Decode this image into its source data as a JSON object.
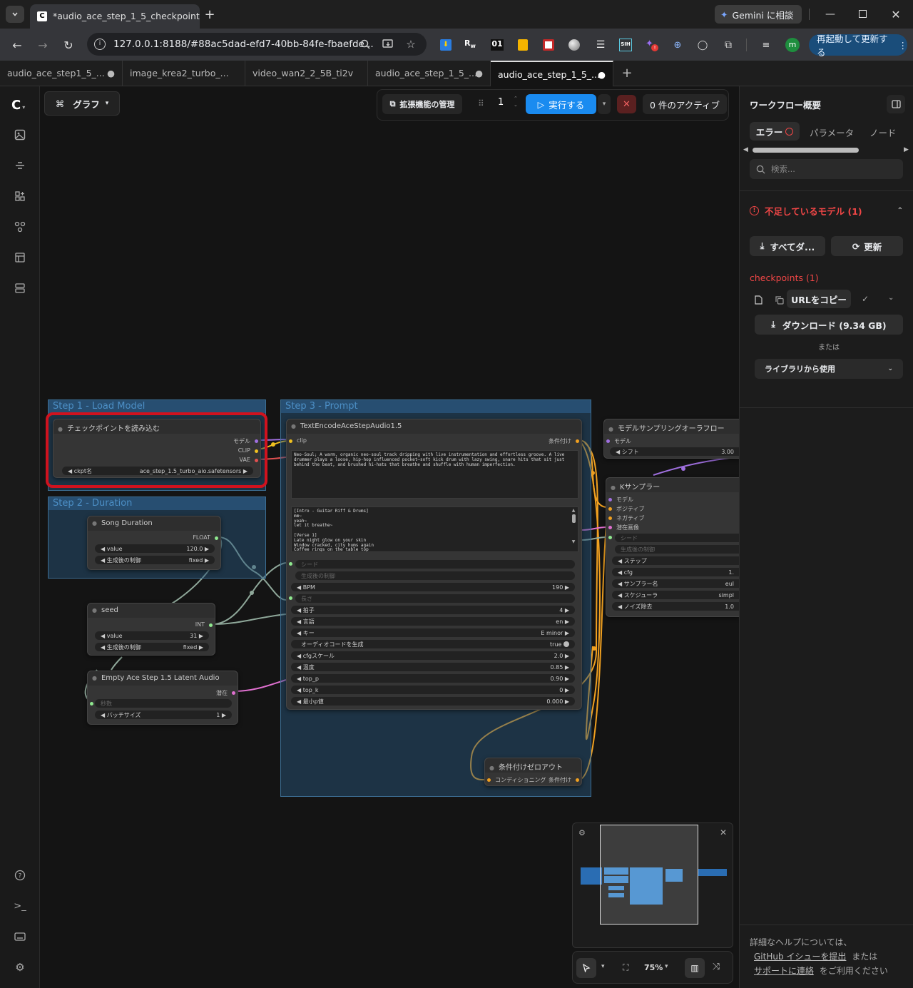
{
  "browser": {
    "active_tab_title": "*audio_ace_step_1_5_checkpoint",
    "url": "127.0.0.1:8188/#88ac5dad-efd7-40bb-84fe-fbaefde...",
    "gemini_label": "Gemini に相談",
    "restart_label": "再起動して更新する",
    "ext_text_01": "01",
    "profile_initial": "m"
  },
  "workflow_tabs": [
    {
      "label": "audio_ace_step1_5_..."
    },
    {
      "label": "image_krea2_turbo_..."
    },
    {
      "label": "video_wan2_2_5B_ti2v"
    },
    {
      "label": "audio_ace_step_1_5_..."
    },
    {
      "label": "audio_ace_step_1_5_..."
    }
  ],
  "canvas_toolbar": {
    "graph_label": "グラフ",
    "extensions_label": "拡張機能の管理",
    "queue_count": "1",
    "run_label": "実行する",
    "active_label": "0 件のアクティブ"
  },
  "groups": {
    "step1": "Step 1 - Load Model",
    "step2": "Step 2 - Duration",
    "step3": "Step 3 - Prompt"
  },
  "nodes": {
    "checkpoint": {
      "title": "チェックポイントを読み込む",
      "out_model": "モデル",
      "out_clip": "CLIP",
      "out_vae": "VAE",
      "ckpt_label": "ckpt名",
      "ckpt_value": "ace_step_1.5_turbo_aio.safetensors"
    },
    "song_duration": {
      "title": "Song Duration",
      "out": "FLOAT",
      "value_label": "value",
      "value": "120.0",
      "control_label": "生成後の制御",
      "control_value": "fixed"
    },
    "seed": {
      "title": "seed",
      "out": "INT",
      "value_label": "value",
      "value": "31",
      "control_label": "生成後の制御",
      "control_value": "fixed"
    },
    "latent": {
      "title": "Empty Ace Step 1.5 Latent Audio",
      "out": "潜在",
      "seconds_label": "秒数",
      "batch_label": "バッチサイズ",
      "batch_value": "1"
    },
    "text_encode": {
      "title": "TextEncodeAceStepAudio1.5",
      "in_clip": "clip",
      "out_cond": "条件付け",
      "tags": "Neo-Soul; A warm, organic neo-soul track dripping with live instrumentation and effortless groove. A live drummer plays a loose, hip-hop influenced pocket—soft kick drum with lazy swing, snare hits that sit just behind the beat, and brushed hi-hats that breathe and shuffle with human imperfection.",
      "lyrics": "[Intro - Guitar Riff & Drums]\nmm~\nyeah~\nlet it breathe~\n\n[Verse 1]\nLate night glow on your skin\nWindow cracked, city hums again\nCoffee rings on the table top",
      "seed_label": "シード",
      "control_label": "生成後の制御",
      "bpm_label": "BPM",
      "bpm_value": "190",
      "duration_label": "長さ",
      "timesig_label": "拍子",
      "timesig_value": "4",
      "lang_label": "言語",
      "lang_value": "en",
      "key_label": "キー",
      "key_value": "E minor",
      "audio_code_label": "オーディオコードを生成",
      "audio_code_value": "true",
      "cfg_label": "cfgスケール",
      "cfg_value": "2.0",
      "temp_label": "温度",
      "temp_value": "0.85",
      "topp_label": "top_p",
      "topp_value": "0.90",
      "topk_label": "top_k",
      "topk_value": "0",
      "minp_label": "最小p値",
      "minp_value": "0.000"
    },
    "zero_out": {
      "title": "条件付けゼロアウト",
      "in": "コンディショニング",
      "out": "条件付け"
    },
    "model_sampling": {
      "title": "モデルサンプリングオーラフロー",
      "in": "モデル",
      "shift_label": "シフト",
      "shift_value": "3.00"
    },
    "ksampler": {
      "title": "Kサンプラー",
      "in_model": "モデル",
      "in_pos": "ポジティブ",
      "in_neg": "ネガティブ",
      "in_latent": "潜在画像",
      "seed_label": "シード",
      "control_label": "生成後の制御",
      "steps_label": "ステップ",
      "cfg_label": "cfg",
      "cfg_value": "1.",
      "sampler_label": "サンプラー名",
      "sampler_value": "eul",
      "scheduler_label": "スケジューラ",
      "scheduler_value": "simpl",
      "denoise_label": "ノイズ除去",
      "denoise_value": "1.0"
    }
  },
  "zoom": {
    "value": "75%"
  },
  "right_panel": {
    "title": "ワークフロー概要",
    "tabs": [
      "エラー",
      "パラメータ",
      "ノード"
    ],
    "search_placeholder": "検索...",
    "missing_models": "不足しているモデル (1)",
    "download_all": "すべてダ...",
    "refresh": "更新",
    "category": "checkpoints (1)",
    "copy_url": "URLをコピー",
    "download": "ダウンロード (9.34 GB)",
    "or": "または",
    "use_library": "ライブラリから使用",
    "help_text": "詳細なヘルプについては、",
    "github_link": "GitHub イシューを提出",
    "or2": "または",
    "support_link": "サポートに連絡",
    "help_suffix": "をご利用ください"
  },
  "colors": {
    "accent": "#1a8bf0",
    "highlight_red": "#d0121e",
    "error_red": "#f04646",
    "wire_orange": "#f0a020",
    "wire_pink": "#e070d0",
    "wire_purple": "#a070e0"
  }
}
